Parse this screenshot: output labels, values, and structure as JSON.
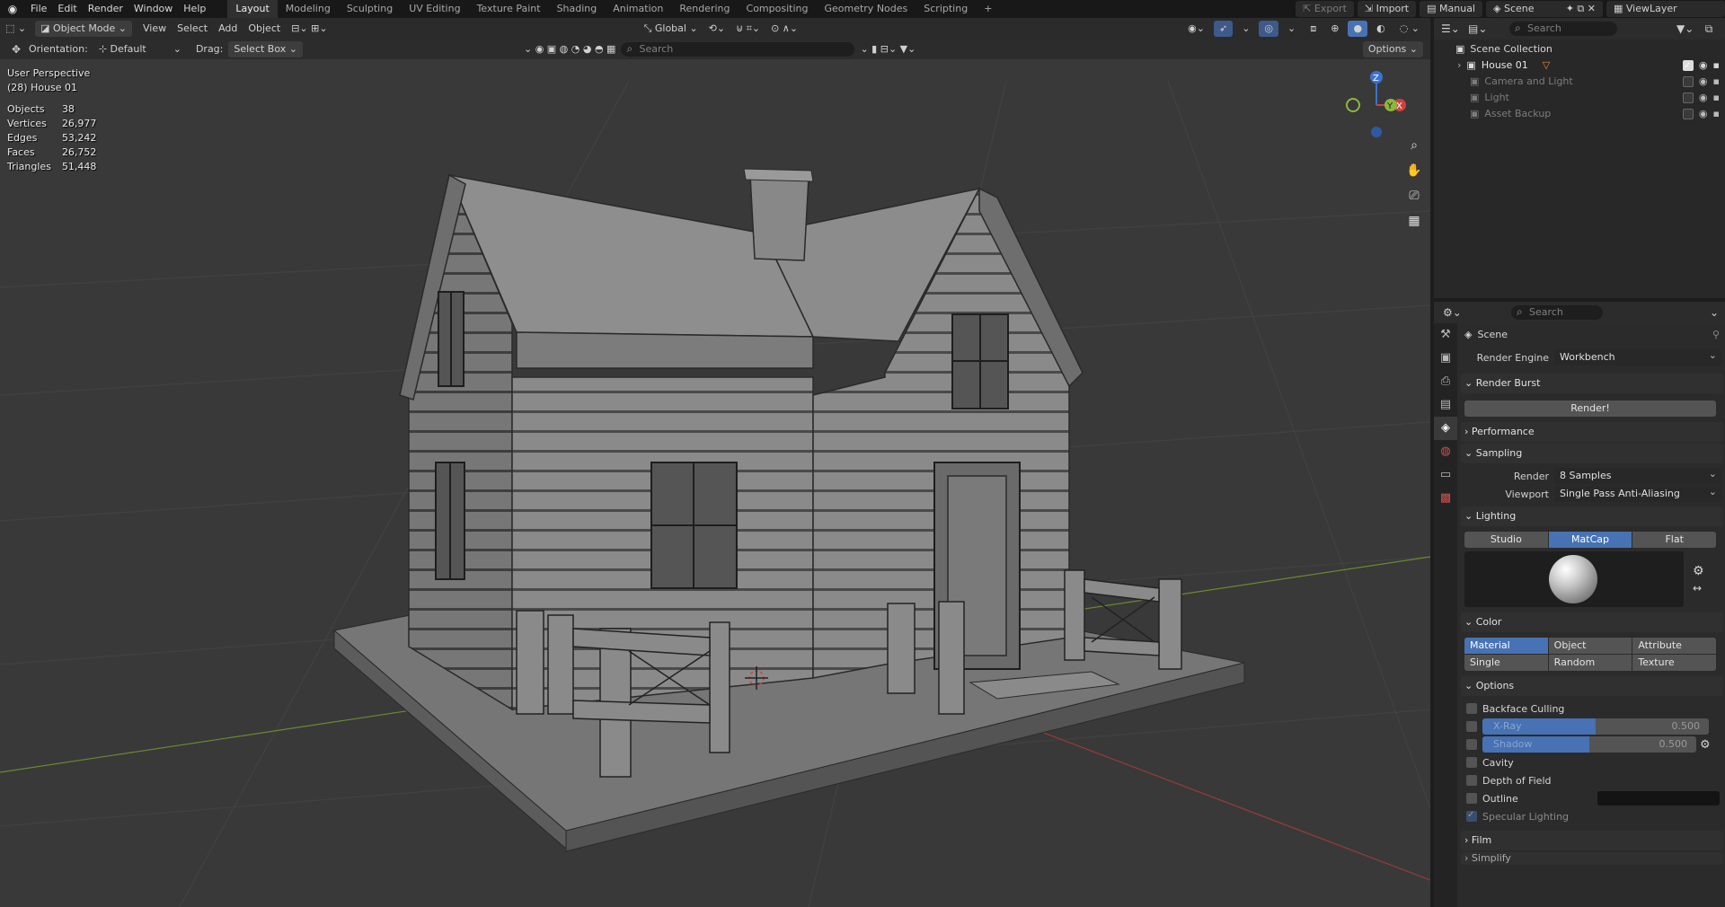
{
  "topbar": {
    "menus": [
      "File",
      "Edit",
      "Render",
      "Window",
      "Help"
    ],
    "workspaces": [
      "Layout",
      "Modeling",
      "Sculpting",
      "UV Editing",
      "Texture Paint",
      "Shading",
      "Animation",
      "Rendering",
      "Compositing",
      "Geometry Nodes",
      "Scripting"
    ],
    "active_workspace": "Layout",
    "add_workspace": "+",
    "export_label": "Export",
    "import_label": "Import",
    "manual_label": "Manual",
    "scene_label": "Scene",
    "viewlayer_label": "ViewLayer"
  },
  "viewport": {
    "header": {
      "mode": "Object Mode",
      "menus": [
        "View",
        "Select",
        "Add",
        "Object"
      ],
      "transform_orientation": "Global",
      "options_label": "Options"
    },
    "toolsettings": {
      "orientation_label": "Orientation:",
      "orientation_value": "Default",
      "drag_label": "Drag:",
      "drag_value": "Select Box",
      "search_placeholder": "Search"
    },
    "overlay_text": {
      "perspective": "User Perspective",
      "object_name": "(28) House 01"
    },
    "stats": [
      {
        "label": "Objects",
        "value": "38"
      },
      {
        "label": "Vertices",
        "value": "26,977"
      },
      {
        "label": "Edges",
        "value": "53,242"
      },
      {
        "label": "Faces",
        "value": "26,752"
      },
      {
        "label": "Triangles",
        "value": "51,448"
      }
    ],
    "gizmo": {
      "x": "X",
      "y": "Y",
      "z": "Z"
    }
  },
  "outliner": {
    "search_placeholder": "Search",
    "root": "Scene Collection",
    "items": [
      {
        "name": "House 01",
        "dim": false
      },
      {
        "name": "Camera and Light",
        "dim": true
      },
      {
        "name": "Light",
        "dim": true
      },
      {
        "name": "Asset Backup",
        "dim": true
      }
    ]
  },
  "properties": {
    "search_placeholder": "Search",
    "context": "Scene",
    "render_engine_label": "Render Engine",
    "render_engine_value": "Workbench",
    "panels": {
      "render_burst": "Render Burst",
      "render_button": "Render!",
      "performance": "Performance",
      "sampling": "Sampling",
      "sampling_render_label": "Render",
      "sampling_render_value": "8 Samples",
      "sampling_viewport_label": "Viewport",
      "sampling_viewport_value": "Single Pass Anti-Aliasing",
      "lighting": "Lighting",
      "lighting_modes": [
        "Studio",
        "MatCap",
        "Flat"
      ],
      "lighting_active": "MatCap",
      "color": "Color",
      "color_modes_row1": [
        "Material",
        "Object",
        "Attribute"
      ],
      "color_modes_row2": [
        "Single",
        "Random",
        "Texture"
      ],
      "color_active": "Material",
      "options": "Options",
      "backface_culling": "Backface Culling",
      "xray_label": "X-Ray",
      "xray_value": "0.500",
      "xray_fraction": 0.5,
      "shadow_label": "Shadow",
      "shadow_value": "0.500",
      "shadow_fraction": 0.5,
      "cavity": "Cavity",
      "depth_of_field": "Depth of Field",
      "outline": "Outline",
      "specular_lighting": "Specular Lighting",
      "film": "Film",
      "simplify": "Simplify"
    }
  },
  "colors": {
    "accent": "#4772b3",
    "viewport_bg": "#393939",
    "panel_bg": "#2b2b2b"
  }
}
